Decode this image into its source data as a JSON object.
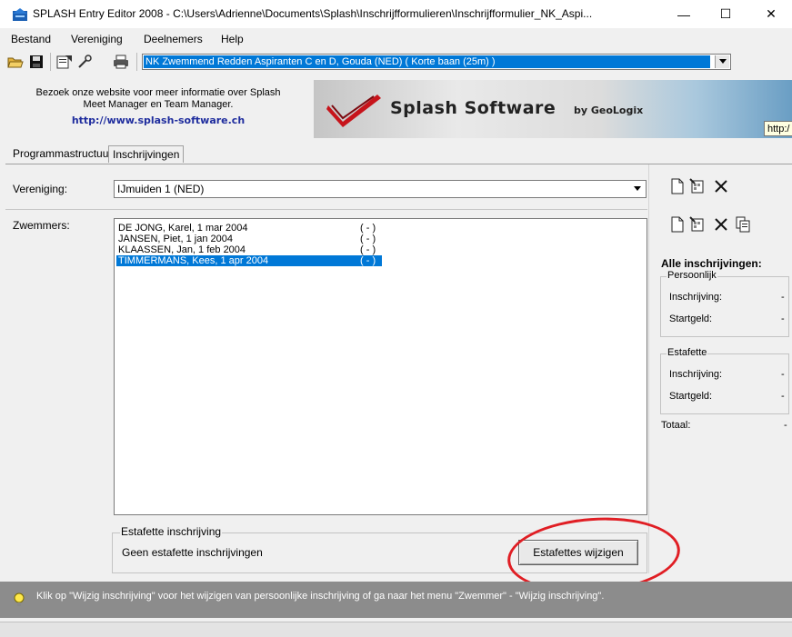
{
  "window": {
    "title": "SPLASH Entry Editor 2008 - C:\\Users\\Adrienne\\Documents\\Splash\\Inschrijfformulieren\\Inschrijfformulier_NK_Aspi...",
    "minimize": "—",
    "maximize": "☐",
    "close": "✕"
  },
  "menu": [
    "Bestand",
    "Vereniging",
    "Deelnemers",
    "Help"
  ],
  "toolbar": {
    "meet_select": "NK Zwemmend Redden Aspiranten C en D,  Gouda  (NED)   ( Korte baan (25m) )",
    "icons": [
      "open-icon",
      "save-icon",
      "properties-icon",
      "wrench-icon",
      "print-icon"
    ]
  },
  "banner": {
    "line1": "Bezoek onze website voor meer informatie over Splash",
    "line2": "Meet Manager en Team Manager.",
    "url": "http://www.splash-software.ch",
    "brand": "Splash Software",
    "by": "by GeoLogix",
    "tooltip": "http:/"
  },
  "tabs": [
    {
      "label": "Programmastructuur",
      "active": false
    },
    {
      "label": "Inschrijvingen",
      "active": true
    }
  ],
  "form": {
    "club_label": "Vereniging:",
    "club_value": "IJmuiden 1 (NED)",
    "swimmers_label": "Zwemmers:",
    "swimmers": [
      {
        "name": "DE JONG, Karel, 1 mar 2004",
        "status": "( - )",
        "selected": false
      },
      {
        "name": "JANSEN, Piet, 1 jan 2004",
        "status": "( - )",
        "selected": false
      },
      {
        "name": "KLAASSEN, Jan, 1 feb 2004",
        "status": "( - )",
        "selected": false
      },
      {
        "name": "TIMMERMANS, Kees, 1 apr 2004",
        "status": "( - )",
        "selected": true
      }
    ],
    "relay_group_title": "Estafette inschrijving",
    "relay_text": "Geen estafette inschrijvingen",
    "relay_button": "Estafettes wijzigen"
  },
  "summary": {
    "title": "Alle inschrijvingen:",
    "personal": {
      "title": "Persoonlijk",
      "entry_label": "Inschrijving:",
      "entry_value": "-",
      "fee_label": "Startgeld:",
      "fee_value": "-"
    },
    "relay": {
      "title": "Estafette",
      "entry_label": "Inschrijving:",
      "entry_value": "-",
      "fee_label": "Startgeld:",
      "fee_value": "-"
    },
    "total_label": "Totaal:",
    "total_value": "-"
  },
  "status": {
    "text": "Klik op \"Wijzig inschrijving\" voor het wijzigen van persoonlijke inschrijving of ga naar het menu \"Zwemmer\" - \"Wijzig inschrijving\"."
  },
  "colors": {
    "selection": "#0078d7",
    "annotation": "#e01e24",
    "url": "#1f2d9e",
    "status_bar": "#8c8c8c"
  }
}
